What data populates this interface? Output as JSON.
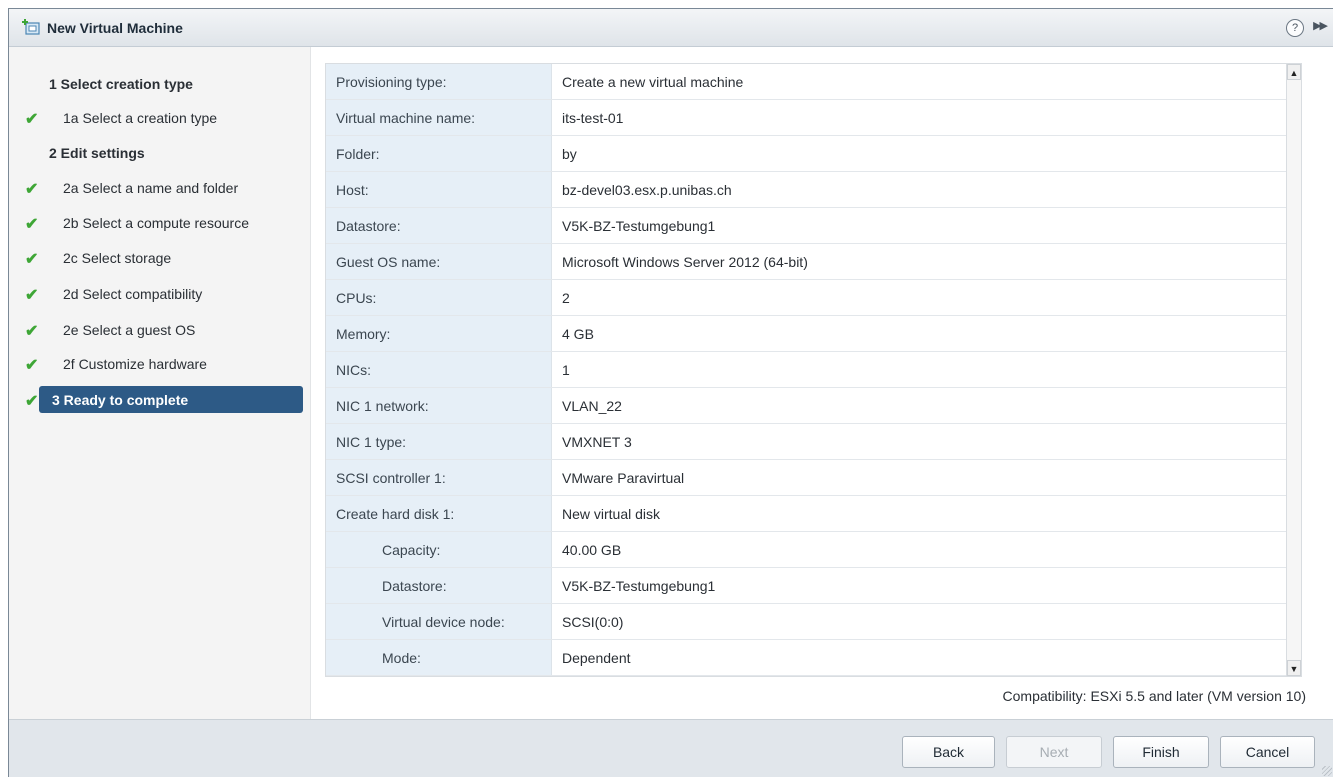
{
  "window": {
    "title": "New Virtual Machine",
    "help_label": "?"
  },
  "colors": {
    "check": "#3ea636",
    "active_step": "#2d5a86",
    "key_column": "#e6eff7"
  },
  "steps": [
    {
      "label": "1  Select creation type",
      "kind": "header",
      "done": false
    },
    {
      "label": "1a  Select a creation type",
      "kind": "sub",
      "done": true
    },
    {
      "label": "2  Edit settings",
      "kind": "header",
      "done": false
    },
    {
      "label": "2a  Select a name and folder",
      "kind": "sub",
      "done": true
    },
    {
      "label": "2b  Select a compute resource",
      "kind": "sub",
      "done": true
    },
    {
      "label": "2c  Select storage",
      "kind": "sub",
      "done": true
    },
    {
      "label": "2d  Select compatibility",
      "kind": "sub",
      "done": true
    },
    {
      "label": "2e  Select a guest OS",
      "kind": "sub",
      "done": true
    },
    {
      "label": "2f  Customize hardware",
      "kind": "sub",
      "done": true
    },
    {
      "label": "3  Ready to complete",
      "kind": "active",
      "done": true
    }
  ],
  "summary": [
    {
      "key": "Provisioning type:",
      "value": "Create a new virtual machine"
    },
    {
      "key": "Virtual machine name:",
      "value": "its-test-01"
    },
    {
      "key": "Folder:",
      "value": "by"
    },
    {
      "key": "Host:",
      "value": "bz-devel03.esx.p.unibas.ch"
    },
    {
      "key": "Datastore:",
      "value": "V5K-BZ-Testumgebung1"
    },
    {
      "key": "Guest OS name:",
      "value": "Microsoft Windows Server 2012 (64-bit)"
    },
    {
      "key": "CPUs:",
      "value": "2"
    },
    {
      "key": "Memory:",
      "value": "4 GB"
    },
    {
      "key": "NICs:",
      "value": "1"
    },
    {
      "key": "NIC 1 network:",
      "value": "VLAN_22"
    },
    {
      "key": "NIC 1 type:",
      "value": "VMXNET 3"
    },
    {
      "key": "SCSI controller 1:",
      "value": "VMware Paravirtual"
    },
    {
      "key": "Create hard disk 1:",
      "value": "New virtual disk"
    },
    {
      "key": "Capacity:",
      "value": "40.00 GB",
      "indent": true
    },
    {
      "key": "Datastore:",
      "value": "V5K-BZ-Testumgebung1",
      "indent": true
    },
    {
      "key": "Virtual device node:",
      "value": "SCSI(0:0)",
      "indent": true
    },
    {
      "key": "Mode:",
      "value": "Dependent",
      "indent": true
    }
  ],
  "compatibility": "Compatibility: ESXi 5.5 and later (VM version 10)",
  "buttons": {
    "back": "Back",
    "next": "Next",
    "finish": "Finish",
    "cancel": "Cancel"
  }
}
